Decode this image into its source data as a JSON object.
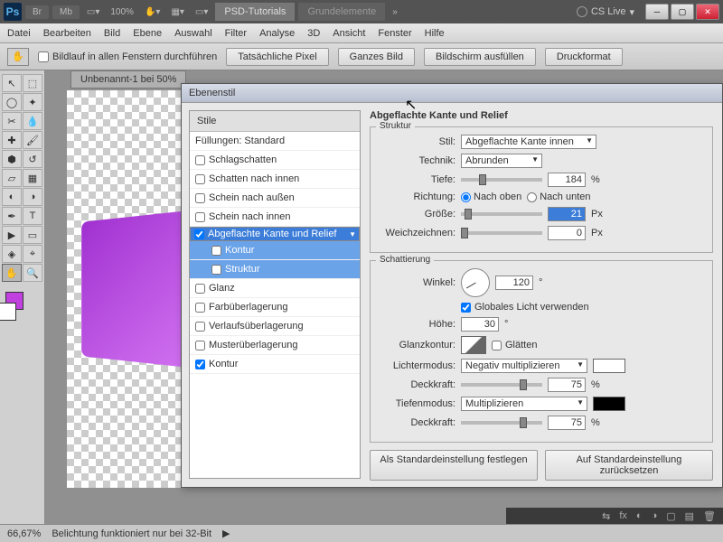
{
  "titlebar": {
    "btns": [
      "Br",
      "Mb"
    ],
    "zoom": "100%",
    "tabs": [
      "PSD-Tutorials",
      "Grundelemente"
    ],
    "cslive": "CS Live"
  },
  "menu": [
    "Datei",
    "Bearbeiten",
    "Bild",
    "Ebene",
    "Auswahl",
    "Filter",
    "Analyse",
    "3D",
    "Ansicht",
    "Fenster",
    "Hilfe"
  ],
  "options": {
    "scroll_all": "Bildlauf in allen Fenstern durchführen",
    "btns": [
      "Tatsächliche Pixel",
      "Ganzes Bild",
      "Bildschirm ausfüllen",
      "Druckformat"
    ]
  },
  "doc_tab": "Unbenannt-1 bei 50%",
  "dialog": {
    "title": "Ebenenstil",
    "styles_hdr": "Stile",
    "items": [
      {
        "label": "Füllungen: Standard",
        "chk": false,
        "nochk": true
      },
      {
        "label": "Schlagschatten",
        "chk": false
      },
      {
        "label": "Schatten nach innen",
        "chk": false
      },
      {
        "label": "Schein nach außen",
        "chk": false
      },
      {
        "label": "Schein nach innen",
        "chk": false
      },
      {
        "label": "Abgeflachte Kante und Relief",
        "chk": true,
        "sel": true
      },
      {
        "label": "Kontur",
        "chk": false,
        "sub": true
      },
      {
        "label": "Struktur",
        "chk": false,
        "sub": true
      },
      {
        "label": "Glanz",
        "chk": false
      },
      {
        "label": "Farbüberlagerung",
        "chk": false
      },
      {
        "label": "Verlaufsüberlagerung",
        "chk": false
      },
      {
        "label": "Musterüberlagerung",
        "chk": false
      },
      {
        "label": "Kontur",
        "chk": true
      }
    ],
    "panel_title": "Abgeflachte Kante und Relief",
    "struktur": {
      "title": "Struktur",
      "stil_lbl": "Stil:",
      "stil_val": "Abgeflachte Kante innen",
      "technik_lbl": "Technik:",
      "technik_val": "Abrunden",
      "tiefe_lbl": "Tiefe:",
      "tiefe_val": "184",
      "tiefe_unit": "%",
      "richtung_lbl": "Richtung:",
      "up": "Nach oben",
      "down": "Nach unten",
      "groesse_lbl": "Größe:",
      "groesse_val": "21",
      "px": "Px",
      "weich_lbl": "Weichzeichnen:",
      "weich_val": "0"
    },
    "schatt": {
      "title": "Schattierung",
      "winkel_lbl": "Winkel:",
      "winkel_val": "120",
      "deg": "°",
      "global": "Globales Licht verwenden",
      "hoehe_lbl": "Höhe:",
      "hoehe_val": "30",
      "glanz_lbl": "Glanzkontur:",
      "glaetten": "Glätten",
      "licht_lbl": "Lichtermodus:",
      "licht_val": "Negativ multiplizieren",
      "deck_lbl": "Deckkraft:",
      "deck1": "75",
      "pct": "%",
      "tief_lbl": "Tiefenmodus:",
      "tief_val": "Multiplizieren",
      "deck2": "75"
    },
    "btn_default": "Als Standardeinstellung festlegen",
    "btn_reset": "Auf Standardeinstellung zurücksetzen"
  },
  "status": {
    "zoom": "66,67%",
    "msg": "Belichtung funktioniert nur bei 32-Bit"
  }
}
